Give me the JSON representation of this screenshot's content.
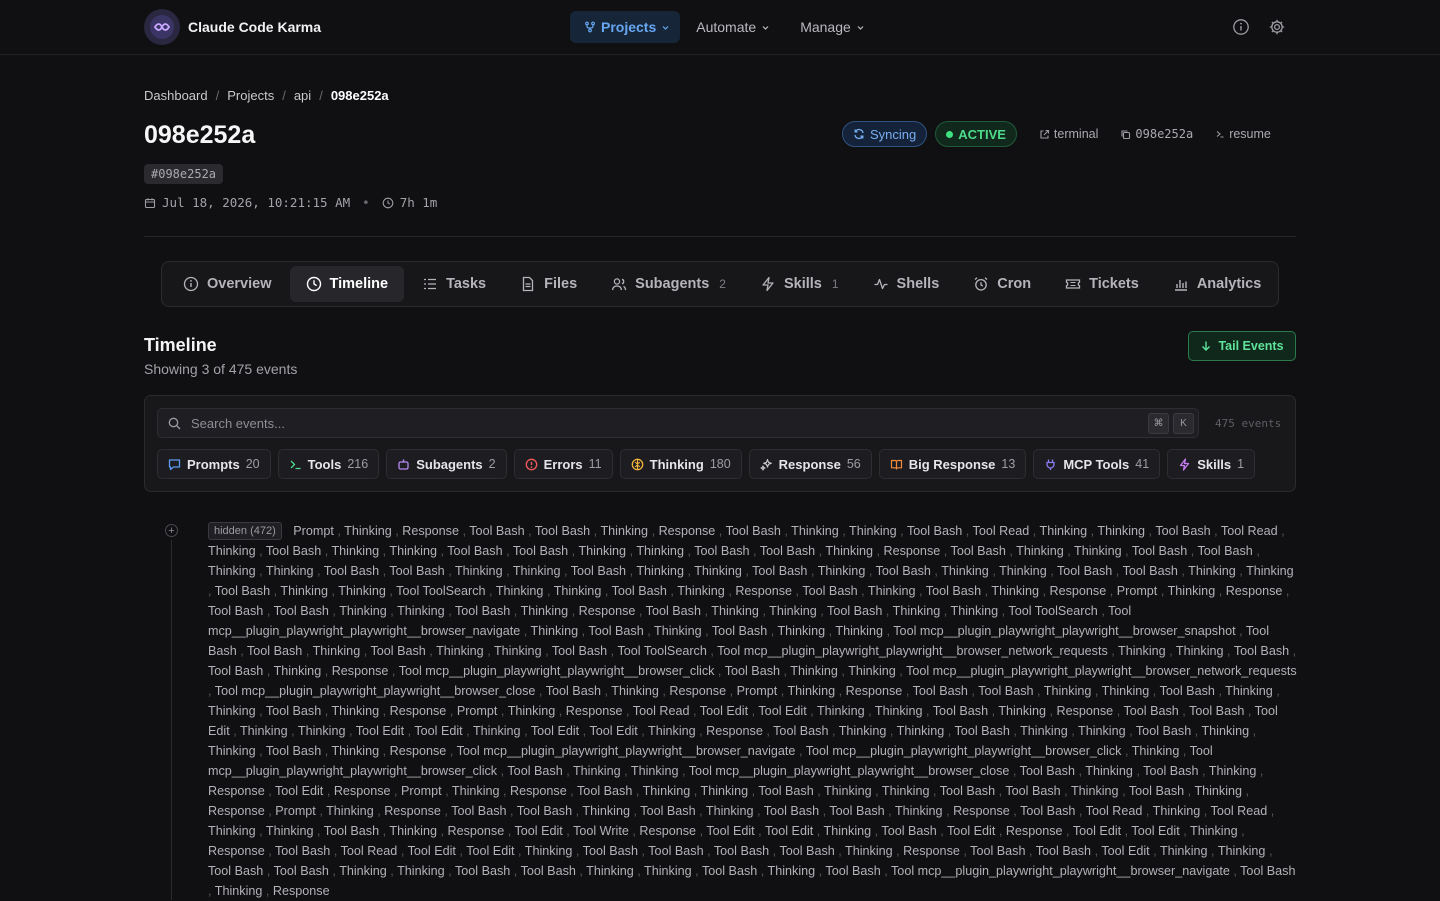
{
  "app": {
    "name": "Claude Code Karma"
  },
  "nav": {
    "items": [
      {
        "label": "Projects",
        "active": true
      },
      {
        "label": "Automate",
        "active": false
      },
      {
        "label": "Manage",
        "active": false
      }
    ]
  },
  "breadcrumb": [
    "Dashboard",
    "Projects",
    "api",
    "098e252a"
  ],
  "session": {
    "title": "098e252a",
    "hash_chip": "#098e252a",
    "date": "Jul 18, 2026, 10:21:15 AM",
    "duration": "7h 1m"
  },
  "actions": {
    "syncing": "Syncing",
    "status": "ACTIVE",
    "terminal": "terminal",
    "session_id": "098e252a",
    "resume": "resume"
  },
  "tabs": [
    {
      "label": "Overview",
      "count": "",
      "icon": "info-icon"
    },
    {
      "label": "Timeline",
      "count": "",
      "icon": "clock-icon",
      "active": true
    },
    {
      "label": "Tasks",
      "count": "",
      "icon": "list-icon"
    },
    {
      "label": "Files",
      "count": "",
      "icon": "file-icon"
    },
    {
      "label": "Subagents",
      "count": "2",
      "icon": "users-icon"
    },
    {
      "label": "Skills",
      "count": "1",
      "icon": "bolt-icon"
    },
    {
      "label": "Shells",
      "count": "",
      "icon": "activity-icon"
    },
    {
      "label": "Cron",
      "count": "",
      "icon": "alarm-icon"
    },
    {
      "label": "Tickets",
      "count": "",
      "icon": "ticket-icon"
    },
    {
      "label": "Analytics",
      "count": "",
      "icon": "chart-icon"
    }
  ],
  "timeline": {
    "title": "Timeline",
    "subtitle": "Showing 3 of 475 events",
    "tail_label": "Tail Events",
    "search_placeholder": "Search events...",
    "kbd": [
      "⌘",
      "K"
    ],
    "event_count": "475 events",
    "filters": [
      {
        "label": "Prompts",
        "count": "20",
        "color": "#5b9cf0"
      },
      {
        "label": "Tools",
        "count": "216",
        "color": "#4fd88c"
      },
      {
        "label": "Subagents",
        "count": "2",
        "color": "#b58cf2"
      },
      {
        "label": "Errors",
        "count": "11",
        "color": "#f25b5b"
      },
      {
        "label": "Thinking",
        "count": "180",
        "color": "#f0b43c"
      },
      {
        "label": "Response",
        "count": "56",
        "color": "#c9c9ce"
      },
      {
        "label": "Big Response",
        "count": "13",
        "color": "#f08a3c"
      },
      {
        "label": "MCP Tools",
        "count": "41",
        "color": "#8a7cf2"
      },
      {
        "label": "Skills",
        "count": "1",
        "color": "#c77cf2"
      }
    ],
    "hidden_label": "hidden (472)",
    "events": [
      "Prompt",
      "Thinking",
      "Response",
      "Tool Bash",
      "Tool Bash",
      "Thinking",
      "Response",
      "Tool Bash",
      "Thinking",
      "Thinking",
      "Tool Bash",
      "Tool Read",
      "Thinking",
      "Thinking",
      "Tool Bash",
      "Tool Read",
      "Thinking",
      "Tool Bash",
      "Thinking",
      "Thinking",
      "Tool Bash",
      "Tool Bash",
      "Thinking",
      "Thinking",
      "Tool Bash",
      "Tool Bash",
      "Thinking",
      "Response",
      "Tool Bash",
      "Thinking",
      "Thinking",
      "Tool Bash",
      "Tool Bash",
      "Thinking",
      "Thinking",
      "Tool Bash",
      "Tool Bash",
      "Thinking",
      "Thinking",
      "Tool Bash",
      "Thinking",
      "Thinking",
      "Tool Bash",
      "Thinking",
      "Tool Bash",
      "Thinking",
      "Thinking",
      "Tool Bash",
      "Tool Bash",
      "Thinking",
      "Thinking",
      "Tool Bash",
      "Thinking",
      "Thinking",
      "Tool ToolSearch",
      "Thinking",
      "Thinking",
      "Tool Bash",
      "Thinking",
      "Response",
      "Tool Bash",
      "Thinking",
      "Tool Bash",
      "Thinking",
      "Response",
      "Prompt",
      "Thinking",
      "Response",
      "Tool Bash",
      "Tool Bash",
      "Thinking",
      "Thinking",
      "Tool Bash",
      "Thinking",
      "Response",
      "Tool Bash",
      "Thinking",
      "Thinking",
      "Tool Bash",
      "Thinking",
      "Thinking",
      "Tool ToolSearch",
      "Tool mcp__plugin_playwright_playwright__browser_navigate",
      "Thinking",
      "Tool Bash",
      "Thinking",
      "Tool Bash",
      "Thinking",
      "Thinking",
      "Tool mcp__plugin_playwright_playwright__browser_snapshot",
      "Tool Bash",
      "Tool Bash",
      "Thinking",
      "Tool Bash",
      "Thinking",
      "Thinking",
      "Tool Bash",
      "Tool ToolSearch",
      "Tool mcp__plugin_playwright_playwright__browser_network_requests",
      "Thinking",
      "Thinking",
      "Tool Bash",
      "Tool Bash",
      "Thinking",
      "Response",
      "Tool mcp__plugin_playwright_playwright__browser_click",
      "Tool Bash",
      "Thinking",
      "Thinking",
      "Tool mcp__plugin_playwright_playwright__browser_network_requests",
      "Tool mcp__plugin_playwright_playwright__browser_close",
      "Tool Bash",
      "Thinking",
      "Response",
      "Prompt",
      "Thinking",
      "Response",
      "Tool Bash",
      "Tool Bash",
      "Thinking",
      "Thinking",
      "Tool Bash",
      "Thinking",
      "Thinking",
      "Tool Bash",
      "Thinking",
      "Response",
      "Prompt",
      "Thinking",
      "Response",
      "Tool Read",
      "Tool Edit",
      "Tool Edit",
      "Thinking",
      "Thinking",
      "Tool Bash",
      "Thinking",
      "Response",
      "Tool Bash",
      "Tool Bash",
      "Tool Edit",
      "Thinking",
      "Thinking",
      "Tool Edit",
      "Tool Edit",
      "Thinking",
      "Tool Edit",
      "Tool Edit",
      "Thinking",
      "Response",
      "Tool Bash",
      "Thinking",
      "Thinking",
      "Tool Bash",
      "Thinking",
      "Thinking",
      "Tool Bash",
      "Thinking",
      "Thinking",
      "Tool Bash",
      "Thinking",
      "Response",
      "Tool mcp__plugin_playwright_playwright__browser_navigate",
      "Tool mcp__plugin_playwright_playwright__browser_click",
      "Thinking",
      "Tool mcp__plugin_playwright_playwright__browser_click",
      "Tool Bash",
      "Thinking",
      "Thinking",
      "Tool mcp__plugin_playwright_playwright__browser_close",
      "Tool Bash",
      "Thinking",
      "Tool Bash",
      "Thinking",
      "Response",
      "Tool Edit",
      "Response",
      "Prompt",
      "Thinking",
      "Response",
      "Tool Bash",
      "Thinking",
      "Thinking",
      "Tool Bash",
      "Thinking",
      "Thinking",
      "Tool Bash",
      "Tool Bash",
      "Thinking",
      "Tool Bash",
      "Thinking",
      "Response",
      "Prompt",
      "Thinking",
      "Response",
      "Tool Bash",
      "Tool Bash",
      "Thinking",
      "Tool Bash",
      "Thinking",
      "Tool Bash",
      "Tool Bash",
      "Thinking",
      "Response",
      "Tool Bash",
      "Tool Read",
      "Thinking",
      "Tool Read",
      "Thinking",
      "Thinking",
      "Tool Bash",
      "Thinking",
      "Response",
      "Tool Edit",
      "Tool Write",
      "Response",
      "Tool Edit",
      "Tool Edit",
      "Thinking",
      "Tool Bash",
      "Tool Edit",
      "Response",
      "Tool Edit",
      "Tool Edit",
      "Thinking",
      "Response",
      "Tool Bash",
      "Tool Read",
      "Tool Edit",
      "Tool Edit",
      "Thinking",
      "Tool Bash",
      "Tool Bash",
      "Tool Bash",
      "Tool Bash",
      "Thinking",
      "Response",
      "Tool Bash",
      "Tool Bash",
      "Tool Edit",
      "Thinking",
      "Thinking",
      "Tool Bash",
      "Tool Bash",
      "Thinking",
      "Thinking",
      "Tool Bash",
      "Tool Bash",
      "Thinking",
      "Thinking",
      "Tool Bash",
      "Thinking",
      "Tool Bash",
      "Tool mcp__plugin_playwright_playwright__browser_navigate",
      "Tool Bash",
      "Thinking",
      "Response"
    ]
  }
}
